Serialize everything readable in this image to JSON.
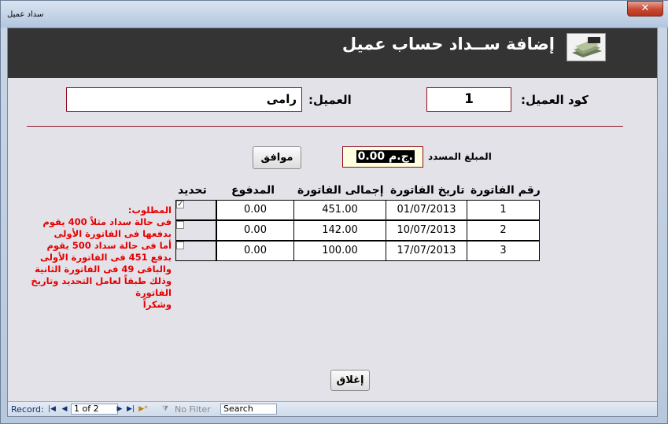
{
  "window": {
    "title": "سداد عميل",
    "close_glyph": "✕"
  },
  "header": {
    "title": "إضافة ســداد حساب عميل",
    "logo_icon": "money-stack-icon"
  },
  "customer": {
    "code_label": "كود العميل:",
    "code_value": "1",
    "name_label": "العميل:",
    "name_value": "رامى"
  },
  "payment": {
    "amount_label": "المبلغ المسدد",
    "amount_value": "0.00 ج.م.",
    "ok_button": "موافق"
  },
  "table": {
    "headers": {
      "invoice_no": "رقم الفاتورة",
      "invoice_date": "تاريخ الفاتورة",
      "invoice_total": "إجمالى الفاتورة",
      "paid": "المدفوع",
      "select": "تحديد"
    },
    "rows": [
      {
        "invoice_no": "1",
        "invoice_date": "01/07/2013",
        "invoice_total": "451.00",
        "paid": "0.00",
        "selected": true
      },
      {
        "invoice_no": "2",
        "invoice_date": "10/07/2013",
        "invoice_total": "142.00",
        "paid": "0.00",
        "selected": false
      },
      {
        "invoice_no": "3",
        "invoice_date": "17/07/2013",
        "invoice_total": "100.00",
        "paid": "0.00",
        "selected": false
      }
    ]
  },
  "note": {
    "lines": [
      "المطلوب:",
      "فى حالة سداد مثلاً 400 يقوم",
      "بدفعها فى الفاتورة الأولى",
      "أما فى حالة سداد 500 يقوم",
      "بدفع 451 فى الفاتورة الأولى",
      "والباقى 49 فى الفاتورة الثانية",
      "وذلك طبقاً لعامل التحديد وتاريخ",
      "الفاتورة",
      "وشكراً"
    ]
  },
  "close_button": "إغلاق",
  "navigation": {
    "record_label": "Record:",
    "record_value": "1 of 2",
    "filter_label": "No Filter",
    "search_label": "Search"
  }
}
